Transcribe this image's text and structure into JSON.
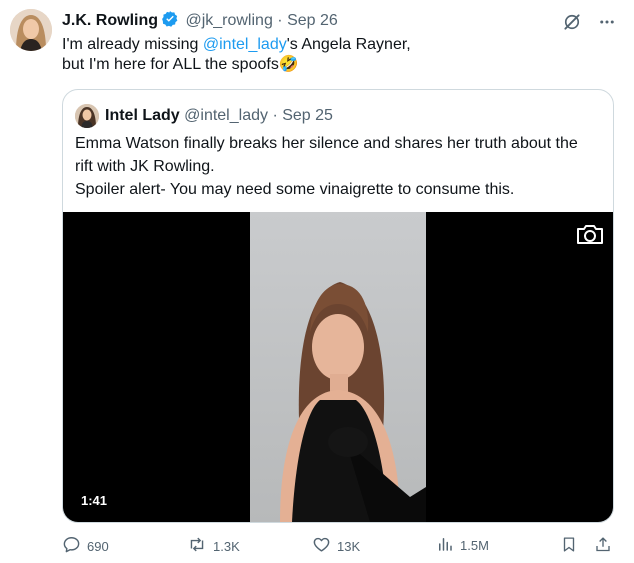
{
  "author": {
    "name": "J.K. Rowling",
    "handle": "@jk_rowling",
    "separator": "·",
    "date": "Sep 26",
    "avatar": "author-avatar-photo"
  },
  "tweet": {
    "text_before": "I'm already missing ",
    "mention": "@intel_lady",
    "text_after": "'s Angela Rayner,",
    "line2": "but I'm here for ALL the spoofs",
    "emoji": "🤣"
  },
  "quote": {
    "name": "Intel Lady",
    "handle": "@intel_lady",
    "separator": "·",
    "date": "Sep 25",
    "line1": "Emma Watson finally breaks her silence and shares her truth about the",
    "line2": "rift with JK Rowling.",
    "line3": "Spoiler alert- You may need some vinaigrette to consume this.",
    "media": {
      "duration": "1:41",
      "icon": "camera-icon"
    }
  },
  "actions": {
    "replies": "690",
    "reposts": "1.3K",
    "likes": "13K",
    "views": "1.5M"
  },
  "icons": {
    "verified": "verified-badge-icon",
    "grok": "grok-icon",
    "more": "more-icon",
    "reply": "reply-icon",
    "repost": "repost-icon",
    "like": "heart-icon",
    "views": "views-icon",
    "bookmark": "bookmark-icon",
    "share": "share-icon"
  },
  "colors": {
    "link": "#1d9bf0",
    "muted": "#536471",
    "text": "#0f1419",
    "border": "#cfd9de",
    "verified": "#1d9bf0"
  }
}
